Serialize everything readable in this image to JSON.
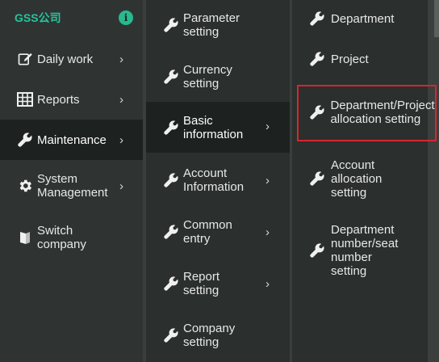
{
  "brand": "GSS公司",
  "col1": {
    "items": [
      {
        "label": "Daily work",
        "icon": "edit-icon"
      },
      {
        "label": "Reports",
        "icon": "table-icon"
      },
      {
        "label": "Maintenance",
        "icon": "wrench-icon"
      },
      {
        "label": "System Management",
        "icon": "gear-icon"
      },
      {
        "label": "Switch company",
        "icon": "book-icon"
      }
    ]
  },
  "col2": {
    "items": [
      {
        "label": "Parameter setting"
      },
      {
        "label": "Currency setting"
      },
      {
        "label": "Basic information"
      },
      {
        "label": "Account Information"
      },
      {
        "label": "Common entry"
      },
      {
        "label": "Report setting"
      },
      {
        "label": "Company setting"
      }
    ]
  },
  "col3": {
    "items": [
      {
        "label": "Department"
      },
      {
        "label": "Project"
      },
      {
        "label": "Department/Project allocation setting"
      },
      {
        "label": "Account allocation setting"
      },
      {
        "label": "Department number/seat number setting"
      }
    ]
  },
  "colors": {
    "brand": "#26c39b",
    "highlight": "#d7262b",
    "active_bg": "#1d2120"
  }
}
